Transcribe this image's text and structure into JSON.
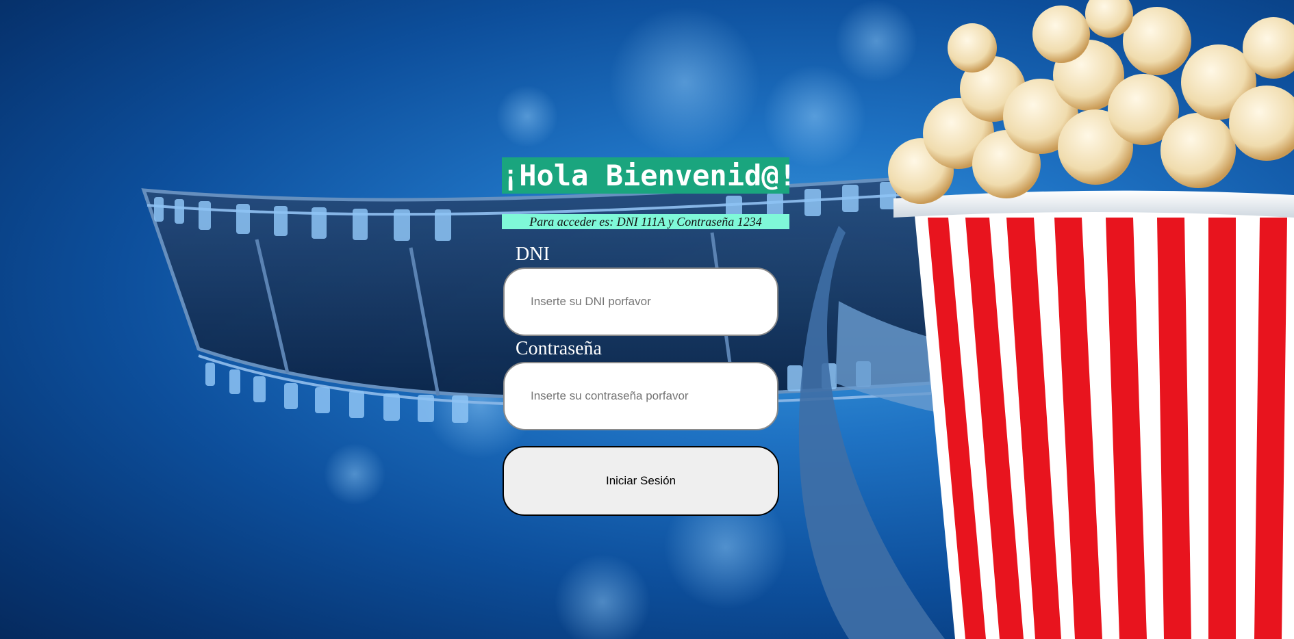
{
  "login": {
    "title": "¡Hola Bienvenid@!",
    "hint": "Para acceder es: DNI 111A y Contraseña 1234",
    "dni_label": "DNI",
    "dni_placeholder": "Inserte su DNI porfavor",
    "dni_value": "",
    "password_label": "Contraseña",
    "password_placeholder": "Inserte su contraseña porfavor",
    "password_value": "",
    "submit_label": "Iniciar Sesión"
  },
  "colors": {
    "title_bg": "#1aa57e",
    "hint_bg": "#7ff8d8",
    "background": "#1f73c4",
    "popcorn_stripe": "#e8141e"
  },
  "background_scene": {
    "icons": [
      "film-strip-icon",
      "popcorn-bucket-icon",
      "bokeh-light-icon"
    ]
  }
}
